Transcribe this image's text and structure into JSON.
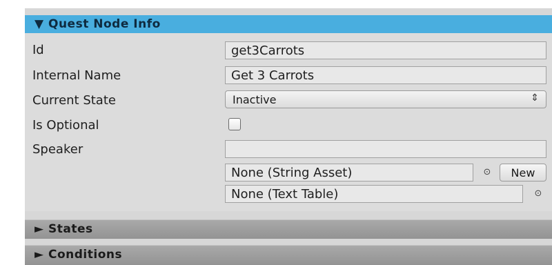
{
  "header": {
    "arrow": "▼",
    "title": "Quest Node Info",
    "color": "#49aedf"
  },
  "fields": {
    "id_label": "Id",
    "id_value": "get3Carrots",
    "internal_name_label": "Internal Name",
    "internal_name_value": "Get 3 Carrots",
    "current_state_label": "Current State",
    "current_state_value": "Inactive",
    "is_optional_label": "Is Optional",
    "is_optional_checked": false,
    "speaker_label": "Speaker",
    "speaker_value": "",
    "string_asset_value": "None (String Asset)",
    "text_table_value": "None (Text Table)",
    "new_label": "New"
  },
  "icons": {
    "dropdown": "⇕",
    "picker": "⊙"
  },
  "foldouts": [
    {
      "arrow": "►",
      "label": "States"
    },
    {
      "arrow": "►",
      "label": "Conditions"
    }
  ]
}
